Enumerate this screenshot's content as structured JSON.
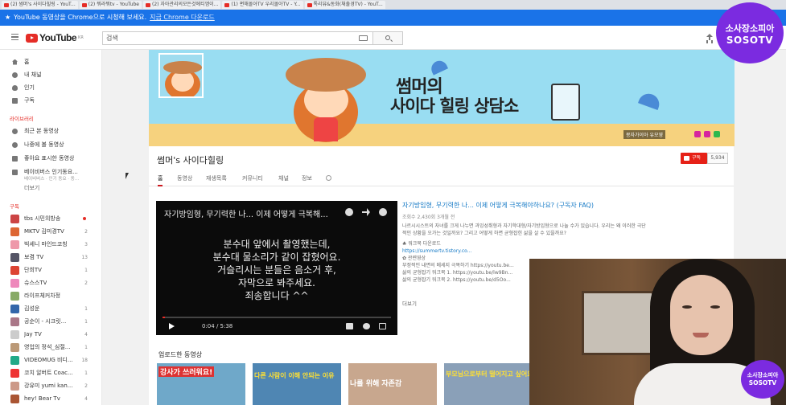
{
  "browser": {
    "tabs": [
      {
        "label": "(2) 썸머's 사이다힐링 - YouT..."
      },
      {
        "label": "(2) 뭐라뭐tv - YouTube"
      },
      {
        "label": "(2) 자아관리의모든것에티엠이..."
      },
      {
        "label": "(1) 편해몰아TV 우리몰아TV - Y..."
      },
      {
        "label": "톡리뷰&동화(채출경TV) - YouT..."
      }
    ]
  },
  "infobar": {
    "message": "YouTube 동영상을 Chrome으로 시청해 보세요.",
    "link": "지금 Chrome 다운로드"
  },
  "header": {
    "logo": "YouTube",
    "logo_sup": "KR",
    "search_placeholder": "검색"
  },
  "sidebar": {
    "main": [
      {
        "label": "홈"
      },
      {
        "label": "내 채널"
      },
      {
        "label": "인기"
      },
      {
        "label": "구독"
      }
    ],
    "library_header": "라이브러리",
    "library": [
      {
        "label": "최근 본 동영상"
      },
      {
        "label": "나중에 볼 동영상"
      },
      {
        "label": "좋아요 표시한 동영상"
      },
      {
        "label": "베이비버스 인기동요..."
      }
    ],
    "library_sub": "베이비버스 · 인기 동요 · 동...",
    "more": "더보기",
    "subs_header": "구독",
    "subs": [
      {
        "label": "tbs 시민의방송",
        "count": ""
      },
      {
        "label": "MKTV 김미경TV",
        "count": "2"
      },
      {
        "label": "빅세니 마인드코칭",
        "count": "3"
      },
      {
        "label": "보겸 TV",
        "count": "13"
      },
      {
        "label": "단희TV",
        "count": "1"
      },
      {
        "label": "슈스스TV",
        "count": "2"
      },
      {
        "label": "라이프체커차정",
        "count": ""
      },
      {
        "label": "김성운",
        "count": "1"
      },
      {
        "label": "공순이 - 시크릿...",
        "count": "1"
      },
      {
        "label": "Jay TV",
        "count": "4"
      },
      {
        "label": "영업의 정석_심절...",
        "count": "1"
      },
      {
        "label": "VIDEOMUG 비디...",
        "count": "18"
      },
      {
        "label": "코치 알버트 Coac...",
        "count": "1"
      },
      {
        "label": "강유미 yumi kan...",
        "count": "2"
      },
      {
        "label": "hey! Bear Tv",
        "count": "4"
      }
    ]
  },
  "banner": {
    "title_line1": "썸머의",
    "title_line2": "사이다 힐링 상담소",
    "corner": "몽자가이아 유모영"
  },
  "channel": {
    "name": "썸머's 사이다힐링",
    "subscribe": "구독",
    "sub_count": "5,934",
    "tabs": [
      "홈",
      "동영상",
      "재생목록",
      "커뮤니티",
      "채널",
      "정보"
    ]
  },
  "featured": {
    "title": "자기방임형, 무기력한 나... 이제 어떻게 극복해...",
    "subtitle": [
      "분수대 앞에서 촬영했는데,",
      "분수대 물소리가 같이 잡혔어요.",
      "거슬리시는 분들은 음소거 후,",
      "자막으로 봐주세요.",
      "죄송합니다 ^^"
    ],
    "time": "0:04 / 5:38",
    "progress": 0.012
  },
  "info": {
    "title": "자기방임형, 무기력한 나... 이제 어떻게 극복해야하나요? (구독자 FAQ)",
    "meta": "조회수 2,430회 3개월 전",
    "desc1": "나르시시스트의 자녀를 크게 나누면 과잉성취형과 자기학대형/자기방임형으로 나눌 수가 있습니다. 우리는 왜 이러한 극단",
    "desc2": "적인 상황을 오가는 것일까요? 그리고 어떻게 하면 균형잡힌 삶을 살 수 있을까요?",
    "wb": "♣ 워크북 다운로드",
    "wb_link": "https://summertv.tistory.co...",
    "rel": "✿ 관련영상",
    "rel1": "부정적인 내면의 메세지 극복하기 https://youtu.be...",
    "rel2": "삶의 균형잡기 워크북 1. https://youtu.be/lw9Bn...",
    "rel3": "삶의 균형잡기 워크북 2. https://youtu.be/d5Oo...",
    "more": "더보기"
  },
  "uploads": {
    "header": "업로드한 동영상",
    "thumbs": [
      "강사가 쓰러워요!",
      "다른 사람이 이해 안되는 이유",
      "나를 위해 자존감",
      "부모님으로부터 떨어지고 싶어요"
    ]
  },
  "watermark": {
    "line1": "소사장소피아",
    "line2": "SOSOTV"
  }
}
